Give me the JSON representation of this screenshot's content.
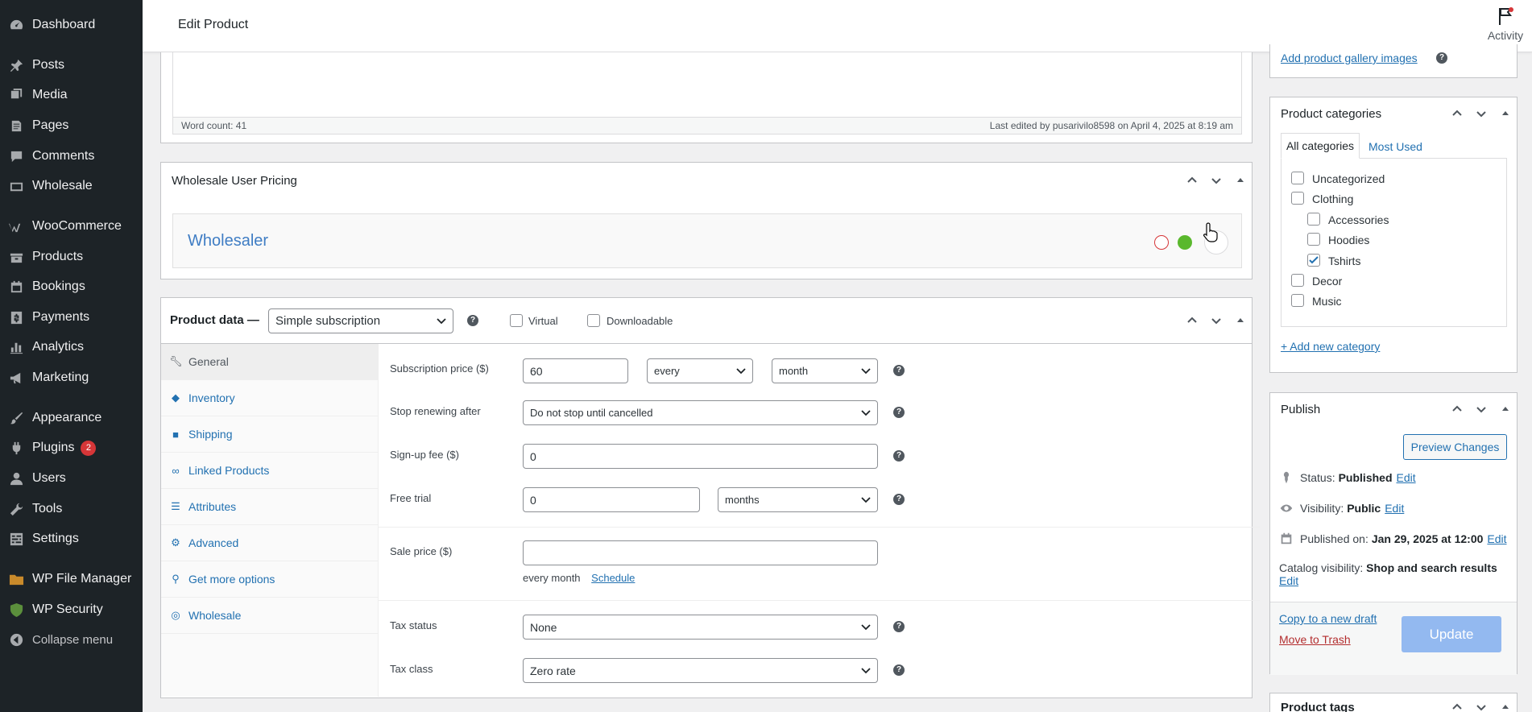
{
  "sidebar": {
    "items": [
      {
        "label": "Dashboard",
        "icon": "dashboard-icon"
      },
      {
        "label": "Posts",
        "icon": "pin-icon"
      },
      {
        "label": "Media",
        "icon": "media-icon"
      },
      {
        "label": "Pages",
        "icon": "pages-icon"
      },
      {
        "label": "Comments",
        "icon": "comments-icon"
      },
      {
        "label": "Wholesale",
        "icon": "wholesale-icon"
      },
      {
        "label": "WooCommerce",
        "icon": "woocommerce-icon"
      },
      {
        "label": "Products",
        "icon": "products-icon"
      },
      {
        "label": "Bookings",
        "icon": "calendar-icon"
      },
      {
        "label": "Payments",
        "icon": "payments-icon"
      },
      {
        "label": "Analytics",
        "icon": "bar-chart-icon"
      },
      {
        "label": "Marketing",
        "icon": "megaphone-icon"
      },
      {
        "label": "Appearance",
        "icon": "brush-icon"
      },
      {
        "label": "Plugins",
        "icon": "plugin-icon",
        "badge": "2"
      },
      {
        "label": "Users",
        "icon": "user-icon"
      },
      {
        "label": "Tools",
        "icon": "wrench-icon"
      },
      {
        "label": "Settings",
        "icon": "settings-icon"
      },
      {
        "label": "WP File Manager",
        "icon": "folder-icon"
      },
      {
        "label": "WP Security",
        "icon": "shield-icon"
      }
    ],
    "collapse_label": "Collapse menu"
  },
  "header": {
    "title": "Edit Product",
    "activity_label": "Activity"
  },
  "editor": {
    "word_count": "Word count: 41",
    "last_edited": "Last edited by pusarivilo8598 on April 4, 2025 at 8:19 am"
  },
  "wholesale_box": {
    "title": "Wholesale User Pricing",
    "role_name": "Wholesaler"
  },
  "product_data": {
    "title": "Product data —",
    "type_selected": "Simple subscription",
    "virtual_label": "Virtual",
    "downloadable_label": "Downloadable",
    "tabs": [
      {
        "label": "General",
        "icon": "wrench-icon"
      },
      {
        "label": "Inventory",
        "icon": "tag-icon"
      },
      {
        "label": "Shipping",
        "icon": "truck-icon"
      },
      {
        "label": "Linked Products",
        "icon": "link-icon"
      },
      {
        "label": "Attributes",
        "icon": "list-icon"
      },
      {
        "label": "Advanced",
        "icon": "gear-icon"
      },
      {
        "label": "Get more options",
        "icon": "plugin-icon"
      },
      {
        "label": "Wholesale",
        "icon": "wholesale-icon"
      }
    ],
    "fields": {
      "subscription_price_label": "Subscription price ($)",
      "subscription_price_value": "60",
      "period_interval": "every",
      "period": "month",
      "stop_renewing_label": "Stop renewing after",
      "stop_renewing_value": "Do not stop until cancelled",
      "signup_fee_label": "Sign-up fee ($)",
      "signup_fee_value": "0",
      "free_trial_label": "Free trial",
      "free_trial_value": "0",
      "free_trial_period": "months",
      "sale_price_label": "Sale price ($)",
      "sale_price_value": "",
      "sale_suffix": "every month",
      "schedule_link": "Schedule",
      "tax_status_label": "Tax status",
      "tax_status_value": "None",
      "tax_class_label": "Tax class",
      "tax_class_value": "Zero rate"
    }
  },
  "gallery": {
    "add_link": "Add product gallery images"
  },
  "categories": {
    "title": "Product categories",
    "tab_all": "All categories",
    "tab_most_used": "Most Used",
    "items": [
      {
        "label": "Uncategorized",
        "checked": false,
        "indent": 0
      },
      {
        "label": "Clothing",
        "checked": false,
        "indent": 0
      },
      {
        "label": "Accessories",
        "checked": false,
        "indent": 1
      },
      {
        "label": "Hoodies",
        "checked": false,
        "indent": 1
      },
      {
        "label": "Tshirts",
        "checked": true,
        "indent": 1
      },
      {
        "label": "Decor",
        "checked": false,
        "indent": 0
      },
      {
        "label": "Music",
        "checked": false,
        "indent": 0
      }
    ],
    "add_new": "+ Add new category"
  },
  "publish": {
    "title": "Publish",
    "preview_button": "Preview Changes",
    "status_label": "Status:",
    "status_value": "Published",
    "visibility_label": "Visibility:",
    "visibility_value": "Public",
    "published_label": "Published on:",
    "published_value": "Jan 29, 2025 at 12:00",
    "catalog_label": "Catalog visibility:",
    "catalog_value": "Shop and search results",
    "edit_link": "Edit",
    "copy_draft": "Copy to a new draft",
    "move_trash": "Move to Trash",
    "update_button": "Update"
  },
  "tags": {
    "title": "Product tags"
  },
  "colors": {
    "sidebar_bg": "#1d2327",
    "link": "#2271b1",
    "badge": "#d63638",
    "trash": "#b32d2e",
    "update_button": "#93b9f0",
    "dot_green": "#5ab82d",
    "dot_red": "#d63638"
  }
}
